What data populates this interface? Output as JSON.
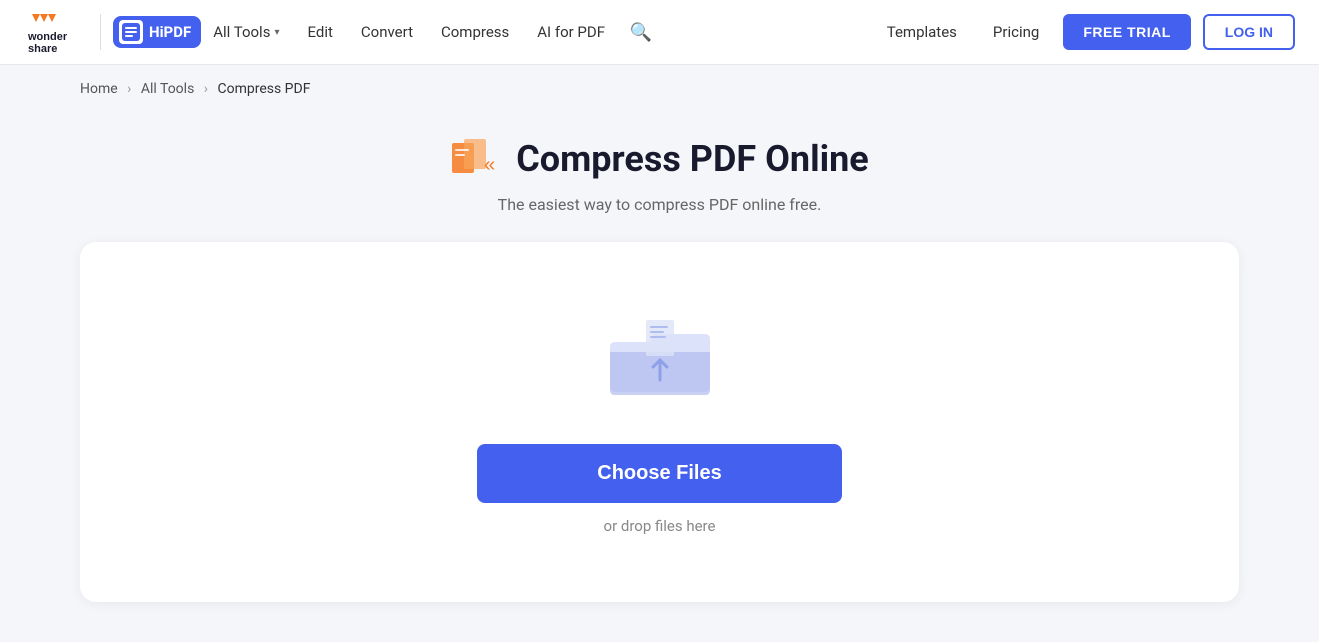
{
  "header": {
    "brand": "Wondershare",
    "hipdf_label": "HiPDF",
    "hipdf_short": "Hi",
    "nav": [
      {
        "id": "all-tools",
        "label": "All Tools",
        "has_chevron": true
      },
      {
        "id": "edit",
        "label": "Edit",
        "has_chevron": false
      },
      {
        "id": "convert",
        "label": "Convert",
        "has_chevron": false
      },
      {
        "id": "compress",
        "label": "Compress",
        "has_chevron": false
      },
      {
        "id": "ai-for-pdf",
        "label": "AI for PDF",
        "has_chevron": false
      }
    ],
    "right_nav": [
      {
        "id": "templates",
        "label": "Templates"
      },
      {
        "id": "pricing",
        "label": "Pricing"
      }
    ],
    "free_trial_label": "FREE TRIAL",
    "login_label": "LOG IN"
  },
  "breadcrumb": {
    "items": [
      {
        "id": "home",
        "label": "Home"
      },
      {
        "id": "all-tools",
        "label": "All Tools"
      },
      {
        "id": "compress-pdf",
        "label": "Compress PDF"
      }
    ]
  },
  "page": {
    "title": "Compress PDF Online",
    "subtitle": "The easiest way to compress PDF online free."
  },
  "dropzone": {
    "choose_files_label": "Choose Files",
    "drop_hint": "or drop files here"
  },
  "colors": {
    "brand_blue": "#4361ee",
    "orange": "#f47920"
  }
}
